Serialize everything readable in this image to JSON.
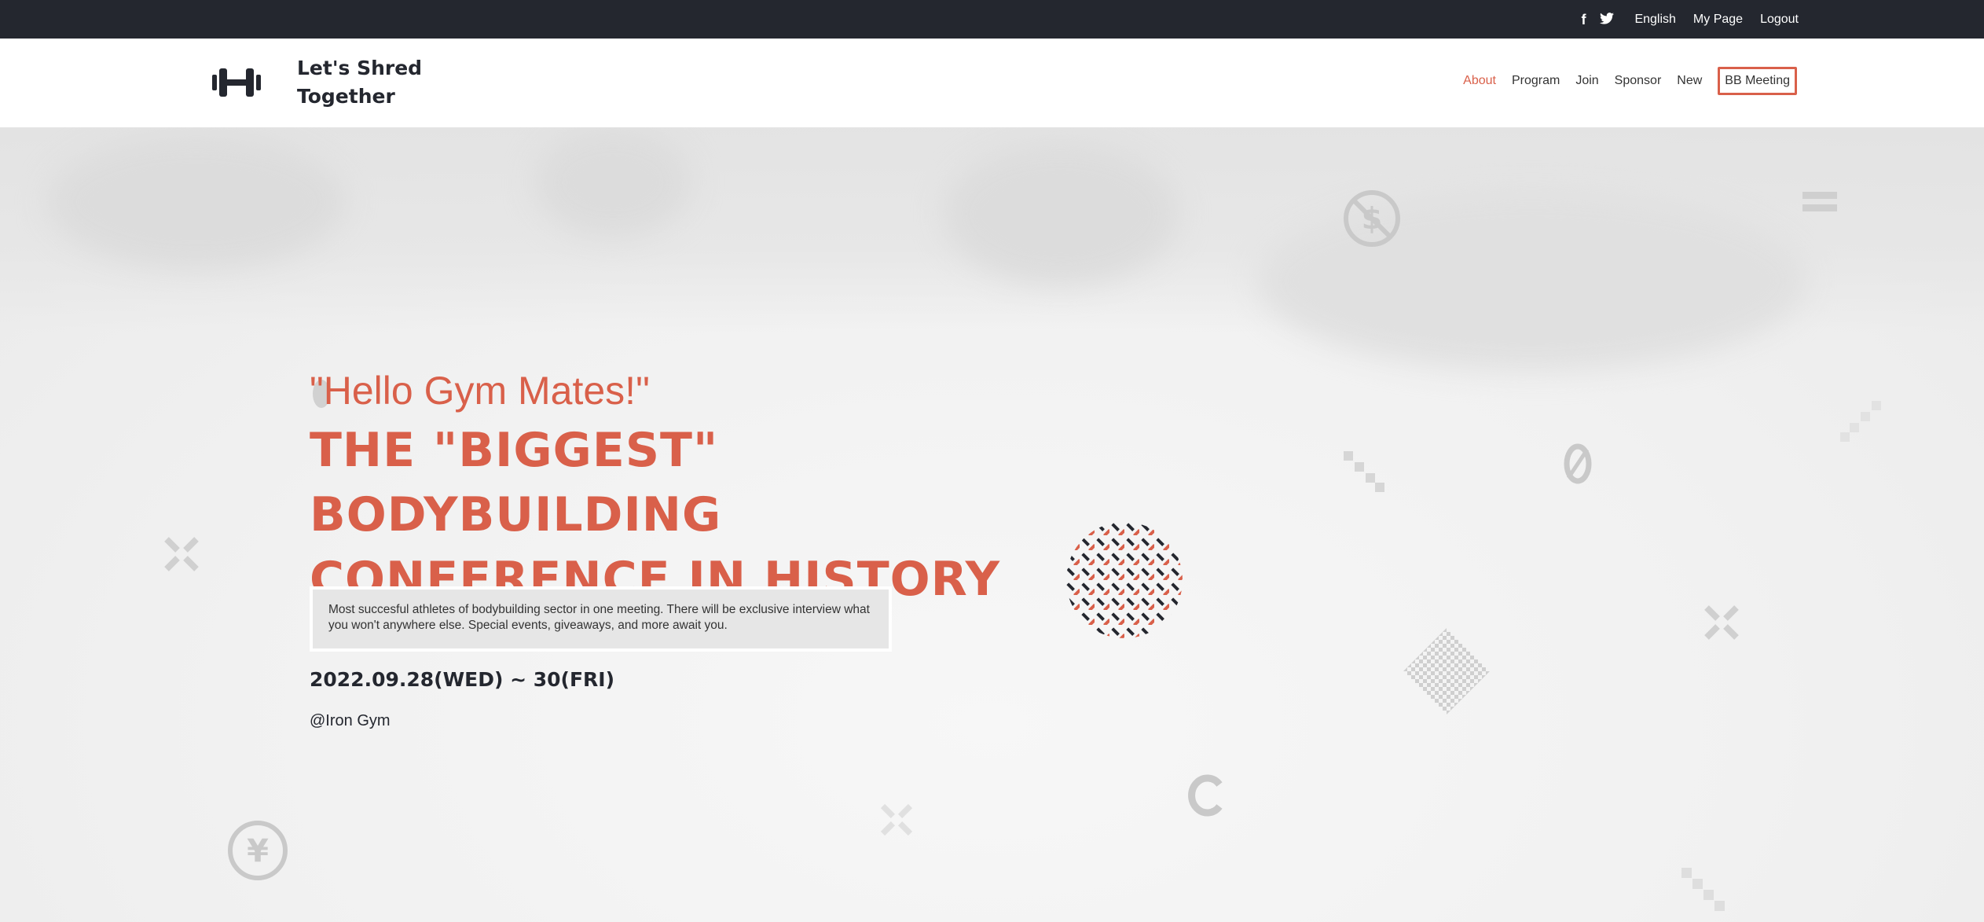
{
  "topbar": {
    "social": [
      {
        "icon": "facebook-icon",
        "glyph": "f"
      },
      {
        "icon": "twitter-icon",
        "glyph": "🐦"
      }
    ],
    "language": "English",
    "my_page": "My Page",
    "logout": "Logout"
  },
  "header": {
    "brand": {
      "line1": "Let's Shred",
      "line2": "Together",
      "logo_icon": "dumbbell-logo-icon"
    },
    "nav": [
      {
        "label": "About",
        "active": true
      },
      {
        "label": "Program"
      },
      {
        "label": "Join"
      },
      {
        "label": "Sponsor"
      },
      {
        "label": "New"
      },
      {
        "label": "BB Meeting",
        "boxed": true
      }
    ]
  },
  "hero": {
    "tagline": "\"Hello Gym Mates!\"",
    "headline_line1": "THE \"BIGGEST\" BODYBUILDING",
    "headline_line2": "CONFERENCE IN HISTORY",
    "description": "Most succesful athletes of bodybuilding sector in one meeting. There will be exclusive interview what you won't anywhere else. Special events, giveaways, and more await you.",
    "date": "2022.09.28(WED) ~ 30(FRI)",
    "venue": "@Iron Gym"
  },
  "colors": {
    "accent": "#d9604a",
    "dark": "#24272f",
    "accent_box": "#e6e6e6"
  }
}
